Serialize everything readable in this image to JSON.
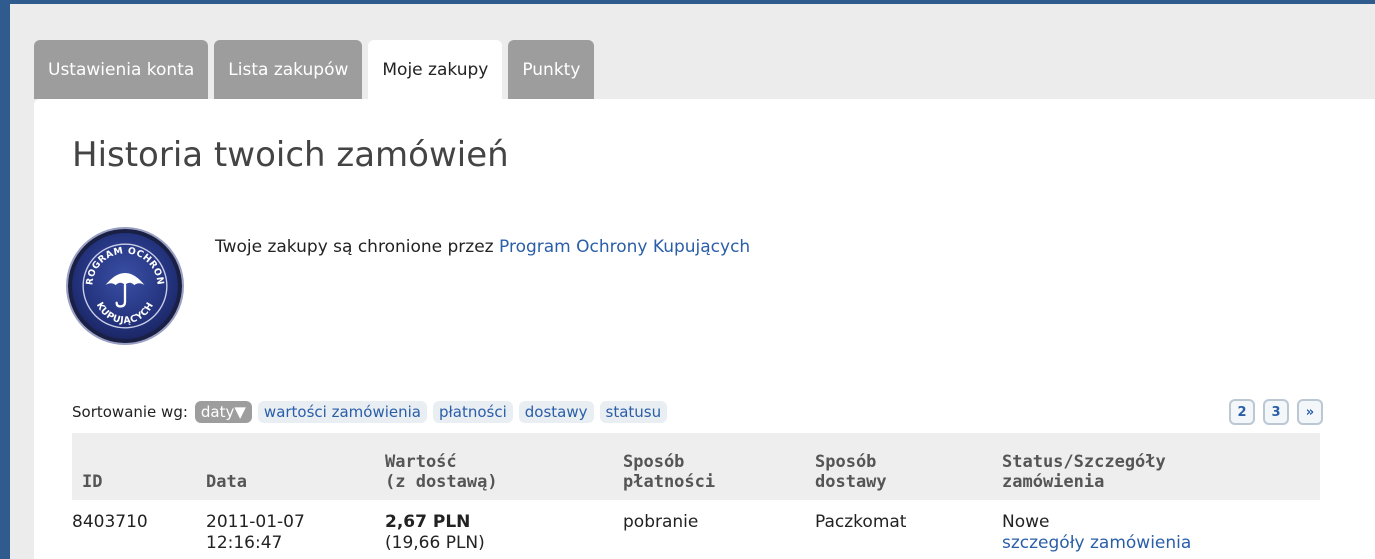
{
  "tabs": [
    {
      "label": "Ustawienia konta"
    },
    {
      "label": "Lista zakupów"
    },
    {
      "label": "Moje zakupy"
    },
    {
      "label": "Punkty"
    }
  ],
  "page_title": "Historia twoich zamówień",
  "protection": {
    "badge_text_top": "PROGRAM OCHRONY",
    "badge_text_bottom": "KUPUJĄCYCH",
    "text": "Twoje zakupy są chronione przez",
    "link": "Program Ochrony Kupujących"
  },
  "sort": {
    "label": "Sortowanie wg:",
    "options": [
      {
        "label": "daty▼",
        "active": true
      },
      {
        "label": "wartości zamówienia"
      },
      {
        "label": "płatności"
      },
      {
        "label": "dostawy"
      },
      {
        "label": "statusu"
      }
    ]
  },
  "pagination": {
    "pages": [
      "2",
      "3"
    ],
    "next": "»"
  },
  "table": {
    "headers": [
      "ID",
      "Data",
      "Wartość\n(z dostawą)",
      "Sposób\npłatności",
      "Sposób\ndostawy",
      "Status/Szczegóły\nzamówienia"
    ],
    "rows": [
      {
        "id": "8403710",
        "date": "2011-01-07",
        "time": "12:16:47",
        "value": "2,67 PLN",
        "value_with_delivery": "(19,66 PLN)",
        "payment": "pobranie",
        "delivery": "Paczkomat",
        "status": "Nowe",
        "details_link": "szczegóły zamówienia"
      }
    ]
  }
}
